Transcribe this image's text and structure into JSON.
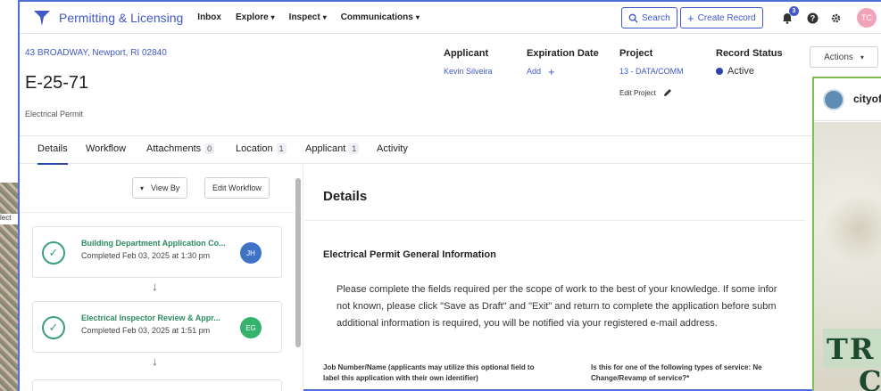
{
  "background": {
    "map_label": "lect"
  },
  "nav": {
    "brand": "Permitting & Licensing",
    "items": [
      {
        "label": "Inbox",
        "chevron": false
      },
      {
        "label": "Explore",
        "chevron": true
      },
      {
        "label": "Inspect",
        "chevron": true
      },
      {
        "label": "Communications",
        "chevron": true
      }
    ],
    "search_label": "Search",
    "create_label": "Create Record",
    "notification_count": "3",
    "avatar_initials": "TC",
    "brand_color": "#4158c9"
  },
  "record": {
    "address": "43 BROADWAY, Newport, RI 02840",
    "id": "E-25-71",
    "type": "Electrical Permit",
    "applicant_label": "Applicant",
    "applicant_value": "Kevin Silveira",
    "expiration_label": "Expiration Date",
    "expiration_value": "Add",
    "project_label": "Project",
    "project_value": "13 - DATA/COMM",
    "edit_project": "Edit Project",
    "status_label": "Record Status",
    "status_value": "Active",
    "actions_label": "Actions"
  },
  "tabs": [
    {
      "label": "Details",
      "count": ""
    },
    {
      "label": "Workflow",
      "count": ""
    },
    {
      "label": "Attachments",
      "count": "0"
    },
    {
      "label": "Location",
      "count": "1"
    },
    {
      "label": "Applicant",
      "count": "1"
    },
    {
      "label": "Activity",
      "count": ""
    }
  ],
  "workflow": {
    "view_by_label": "View By",
    "edit_label": "Edit Workflow",
    "steps": [
      {
        "title": "Building Department Application Co...",
        "subtitle": "Completed Feb 03, 2025 at 1:30 pm",
        "initials": "JH",
        "avatar_color": "#3f73c8"
      },
      {
        "title": "Electrical Inspector Review & Appr...",
        "subtitle": "Completed Feb 03, 2025 at 1:51 pm",
        "initials": "EG",
        "avatar_color": "#33b36b"
      }
    ]
  },
  "details": {
    "heading": "Details",
    "section_title": "Electrical Permit General Information",
    "body_lines": [
      "Please complete the fields required per the scope of work to the best of your knowledge. If some infor",
      "not known, please click \"Save as Draft\" and \"Exit\" and return to complete the application before subm",
      "additional information is required, you will be notified via your registered e-mail address."
    ],
    "field1_line1": "Job Number/Name (applicants may utilize this optional field to",
    "field1_line2": "label this application with their own identifier)",
    "field2_line1": "Is this for one of the following types of service: Ne",
    "field2_line2": "Change/Revamp of service?*"
  },
  "overlay": {
    "org_name": "cityof",
    "banner_line1": "TR",
    "banner_line2": "C"
  }
}
